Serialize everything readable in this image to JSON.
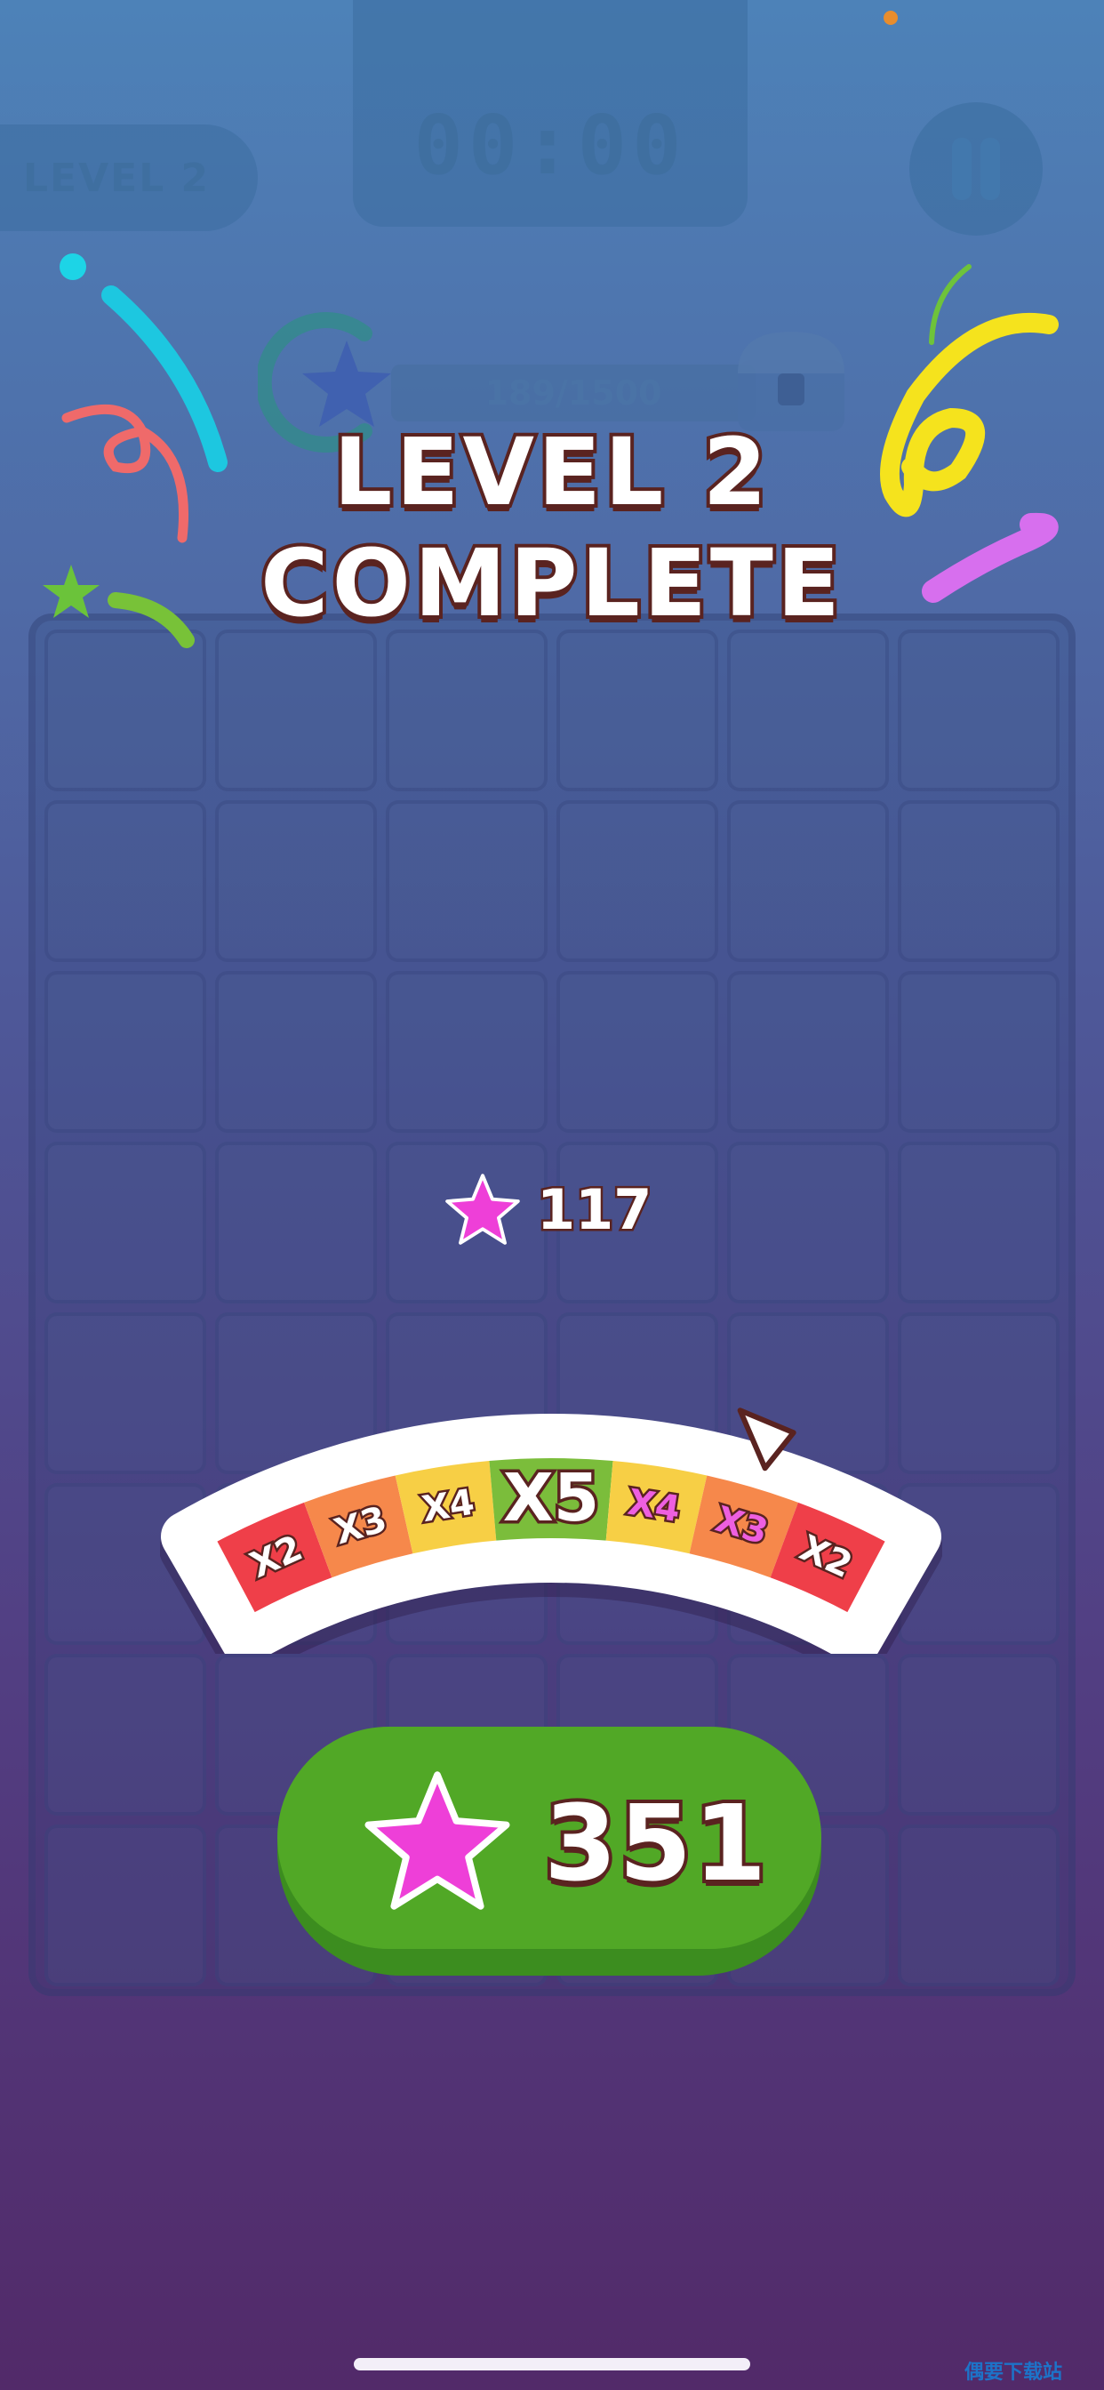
{
  "hud": {
    "level_label": "LEVEL 2",
    "timer": "00:00",
    "progress_text": "189/1500"
  },
  "title": {
    "line1": "LEVEL 2",
    "line2": "COMPLETE"
  },
  "reward": {
    "base_amount": "117"
  },
  "multiplier_wheel": {
    "segments": [
      "X2",
      "X3",
      "X4",
      "X5",
      "X4",
      "X3",
      "X2"
    ],
    "colors": [
      "#ef3f49",
      "#f6884b",
      "#f7cf45",
      "#7bbd3b",
      "#f7cf45",
      "#f6884b",
      "#ef3f49"
    ]
  },
  "claim_button": {
    "amount": "351"
  },
  "watermark": "偶要下载站",
  "colors": {
    "star": "#ee3fd8",
    "button": "#51a826",
    "outline": "#5a2320"
  }
}
